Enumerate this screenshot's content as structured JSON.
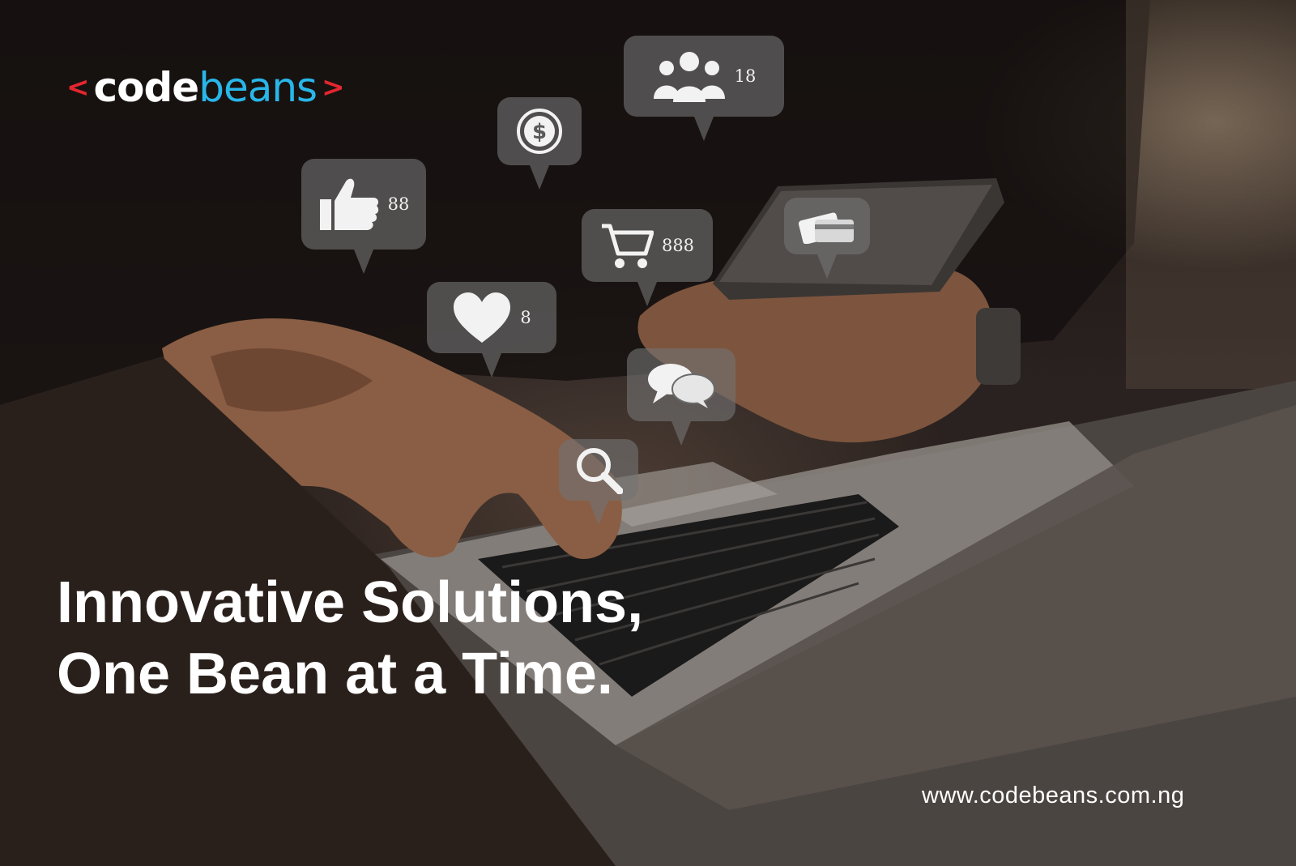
{
  "brand": {
    "left_bracket": "<",
    "name_part1": "code",
    "name_part2": "beans",
    "right_bracket": ">"
  },
  "bubbles": [
    {
      "icon": "people-icon",
      "count": "18"
    },
    {
      "icon": "dollar-icon",
      "count": ""
    },
    {
      "icon": "thumbs-up-icon",
      "count": "88"
    },
    {
      "icon": "cart-icon",
      "count": "888"
    },
    {
      "icon": "credit-card-icon",
      "count": ""
    },
    {
      "icon": "heart-icon",
      "count": "8"
    },
    {
      "icon": "chat-icon",
      "count": ""
    },
    {
      "icon": "search-icon",
      "count": ""
    }
  ],
  "headline": {
    "line1": "Innovative Solutions,",
    "line2": "One Bean at a Time."
  },
  "website": "www.codebeans.com.ng",
  "colors": {
    "brand_red": "#e3262f",
    "brand_blue": "#29b6e8",
    "text": "#ffffff"
  }
}
